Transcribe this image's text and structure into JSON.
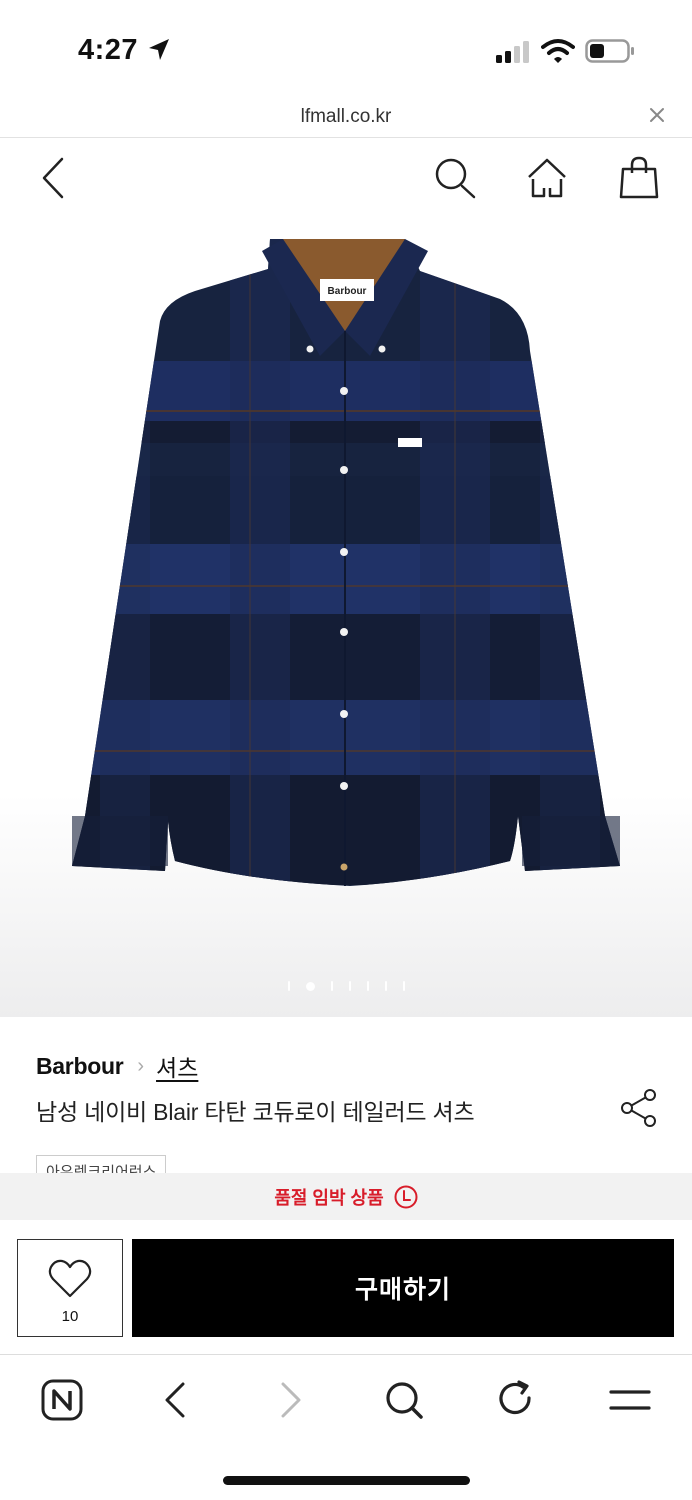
{
  "status_bar": {
    "time": "4:27"
  },
  "browser": {
    "url": "lfmall.co.kr"
  },
  "product": {
    "brand": "Barbour",
    "category": "셔츠",
    "title": "남성 네이비 Blair 타탄 코듀로이 테일러드 셔츠",
    "tag": "아우렛크리어런스",
    "label_text": "Barbour",
    "image_count": 7,
    "active_image_index": 2
  },
  "soldout_banner": {
    "text": "품절 임박 상품"
  },
  "purchase": {
    "wish_count": "10",
    "buy_label": "구매하기"
  },
  "colors": {
    "accent_red": "#d81d2a",
    "button_black": "#000000",
    "shirt_navy": "#1b2a4e"
  }
}
